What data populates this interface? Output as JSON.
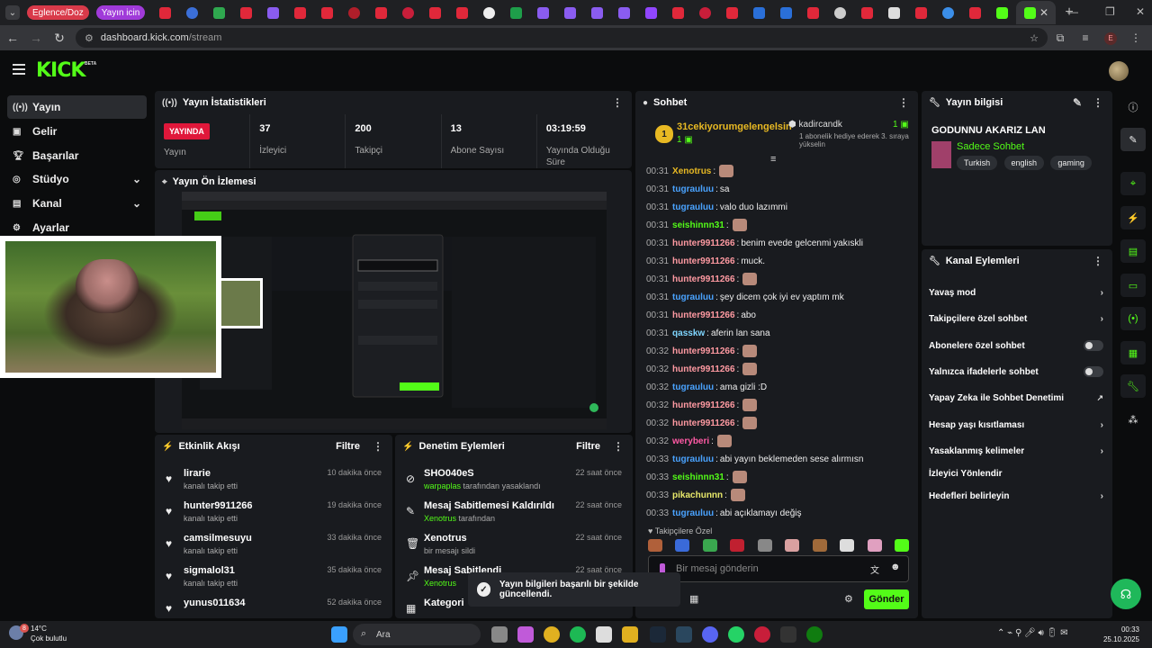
{
  "browser": {
    "tab_groups": [
      "Eglence/Doz",
      "Yayın icin"
    ],
    "url_host": "dashboard.kick.com",
    "url_path": "/stream",
    "profile_initial": "E"
  },
  "app": {
    "logo": "KICK",
    "beta": "BETA"
  },
  "nav": {
    "items": [
      {
        "label": "Yayın",
        "icon": "broadcast-icon"
      },
      {
        "label": "Gelir",
        "icon": "revenue-icon"
      },
      {
        "label": "Başarılar",
        "icon": "trophy-icon"
      },
      {
        "label": "Stüdyo",
        "icon": "studio-icon"
      },
      {
        "label": "Kanal",
        "icon": "channel-icon"
      },
      {
        "label": "Ayarlar",
        "icon": "gear-icon"
      }
    ]
  },
  "stats": {
    "title": "Yayın İstatistikleri",
    "live_badge": "YAYINDA",
    "live_label": "Yayın",
    "viewers_value": "37",
    "viewers_label": "İzleyici",
    "followers_value": "200",
    "followers_label": "Takipçi",
    "subs_value": "13",
    "subs_label": "Abone Sayısı",
    "duration_value": "03:19:59",
    "duration_label": "Yayında Olduğu Süre"
  },
  "preview": {
    "title": "Yayın Ön İzlemesi"
  },
  "activity": {
    "title": "Etkinlik Akışı",
    "filter": "Filtre",
    "rows": [
      {
        "name": "lirarie",
        "sub": "kanalı takip etti",
        "time": "10 dakika önce"
      },
      {
        "name": "hunter9911266",
        "sub": "kanalı takip etti",
        "time": "19 dakika önce"
      },
      {
        "name": "camsilmesuyu",
        "sub": "kanalı takip etti",
        "time": "33 dakika önce"
      },
      {
        "name": "sigmalol31",
        "sub": "kanalı takip etti",
        "time": "35 dakika önce"
      },
      {
        "name": "yunus011634",
        "sub": "",
        "time": "52 dakika önce"
      }
    ]
  },
  "moderation": {
    "title": "Denetim Eylemleri",
    "filter": "Filtre",
    "rows": [
      {
        "title": "SHO040eS",
        "actor": "warpaplas",
        "rest": " tarafından yasaklandı",
        "time": "22 saat önce"
      },
      {
        "title": "Mesaj Sabitlemesi Kaldırıldı",
        "actor": "Xenotrus",
        "rest": " tarafından",
        "time": "22 saat önce"
      },
      {
        "title": "Xenotrus",
        "actor": "",
        "rest": "bir mesajı sildi",
        "time": "22 saat önce"
      },
      {
        "title": "Mesaj Sabitlendi",
        "actor": "Xenotrus",
        "rest": "",
        "time": "22 saat önce"
      },
      {
        "title": "Kategori",
        "actor": "",
        "rest": "",
        "time": ""
      }
    ]
  },
  "chat": {
    "title": "Sohbet",
    "pinned_user": "31cekiyorumgelengelsin",
    "pinned_count": "1",
    "gift_user": "kadircandk",
    "gift_count": "1",
    "gift_text": "1 abonelik hediye ederek 3. sıraya yükselin",
    "messages": [
      {
        "time": "00:31",
        "user": "Xenotrus",
        "color": "#e8b923",
        "text": ""
      },
      {
        "time": "00:31",
        "user": "tugrauluu",
        "color": "#4aa3ff",
        "text": "sa"
      },
      {
        "time": "00:31",
        "user": "tugrauluu",
        "color": "#4aa3ff",
        "text": "valo duo lazımmi"
      },
      {
        "time": "00:31",
        "user": "seishinnn31",
        "color": "#53fc18",
        "text": ""
      },
      {
        "time": "00:31",
        "user": "hunter9911266",
        "color": "#ff9aa2",
        "text": "benim evede gelcenmi yakıskli"
      },
      {
        "time": "00:31",
        "user": "hunter9911266",
        "color": "#ff9aa2",
        "text": "muck."
      },
      {
        "time": "00:31",
        "user": "hunter9911266",
        "color": "#ff9aa2",
        "text": ""
      },
      {
        "time": "00:31",
        "user": "tugrauluu",
        "color": "#4aa3ff",
        "text": "şey dicem çok iyi ev yaptım mk"
      },
      {
        "time": "00:31",
        "user": "hunter9911266",
        "color": "#ff9aa2",
        "text": "abo"
      },
      {
        "time": "00:31",
        "user": "qasskw",
        "color": "#7fd6ff",
        "text": "aferin lan sana"
      },
      {
        "time": "00:32",
        "user": "hunter9911266",
        "color": "#ff9aa2",
        "text": ""
      },
      {
        "time": "00:32",
        "user": "hunter9911266",
        "color": "#ff9aa2",
        "text": ""
      },
      {
        "time": "00:32",
        "user": "tugrauluu",
        "color": "#4aa3ff",
        "text": "ama gizli :D"
      },
      {
        "time": "00:32",
        "user": "hunter9911266",
        "color": "#ff9aa2",
        "text": ""
      },
      {
        "time": "00:32",
        "user": "hunter9911266",
        "color": "#ff9aa2",
        "text": ""
      },
      {
        "time": "00:32",
        "user": "weryberi",
        "color": "#ff5aa5",
        "text": ""
      },
      {
        "time": "00:33",
        "user": "tugrauluu",
        "color": "#4aa3ff",
        "text": "abi yayın beklemeden sese alırmısn"
      },
      {
        "time": "00:33",
        "user": "seishinnn31",
        "color": "#53fc18",
        "text": ""
      },
      {
        "time": "00:33",
        "user": "pikachunnn",
        "color": "#e8e86a",
        "text": ""
      },
      {
        "time": "00:33",
        "user": "tugrauluu",
        "color": "#4aa3ff",
        "text": "abi açıklamayı değiş"
      }
    ],
    "followers_only": "Takipçilere Özel",
    "input_placeholder": "Bir mesaj gönderin",
    "send": "Gönder"
  },
  "stream_info": {
    "title": "Yayın bilgisi",
    "stream_title": "GODUNNU AKARIZ LAN",
    "category": "Sadece Sohbet",
    "tags": [
      "Turkish",
      "english",
      "gaming"
    ]
  },
  "channel_actions": {
    "title": "Kanal Eylemleri",
    "items": [
      {
        "label": "Yavaş mod",
        "kind": "chev"
      },
      {
        "label": "Takipçilere özel sohbet",
        "kind": "chev"
      },
      {
        "label": "Abonelere özel sohbet",
        "kind": "toggle"
      },
      {
        "label": "Yalnızca ifadelerle sohbet",
        "kind": "toggle"
      },
      {
        "label": "Yapay Zeka ile Sohbet Denetimi",
        "kind": "external"
      },
      {
        "label": "Hesap yaşı kısıtlaması",
        "kind": "chev"
      },
      {
        "label": "Yasaklanmış kelimeler",
        "kind": "chev"
      },
      {
        "label": "İzleyici Yönlendir",
        "kind": "none"
      },
      {
        "label": "Hedefleri belirleyin",
        "kind": "chev"
      }
    ]
  },
  "toast": {
    "text": "Yayın bilgileri başarılı bir şekilde güncellendi."
  },
  "taskbar": {
    "temp": "14°C",
    "weather": "Çok bulutlu",
    "weather_badge": "8",
    "search": "Ara",
    "time": "00:33",
    "date": "25.10.2025"
  }
}
